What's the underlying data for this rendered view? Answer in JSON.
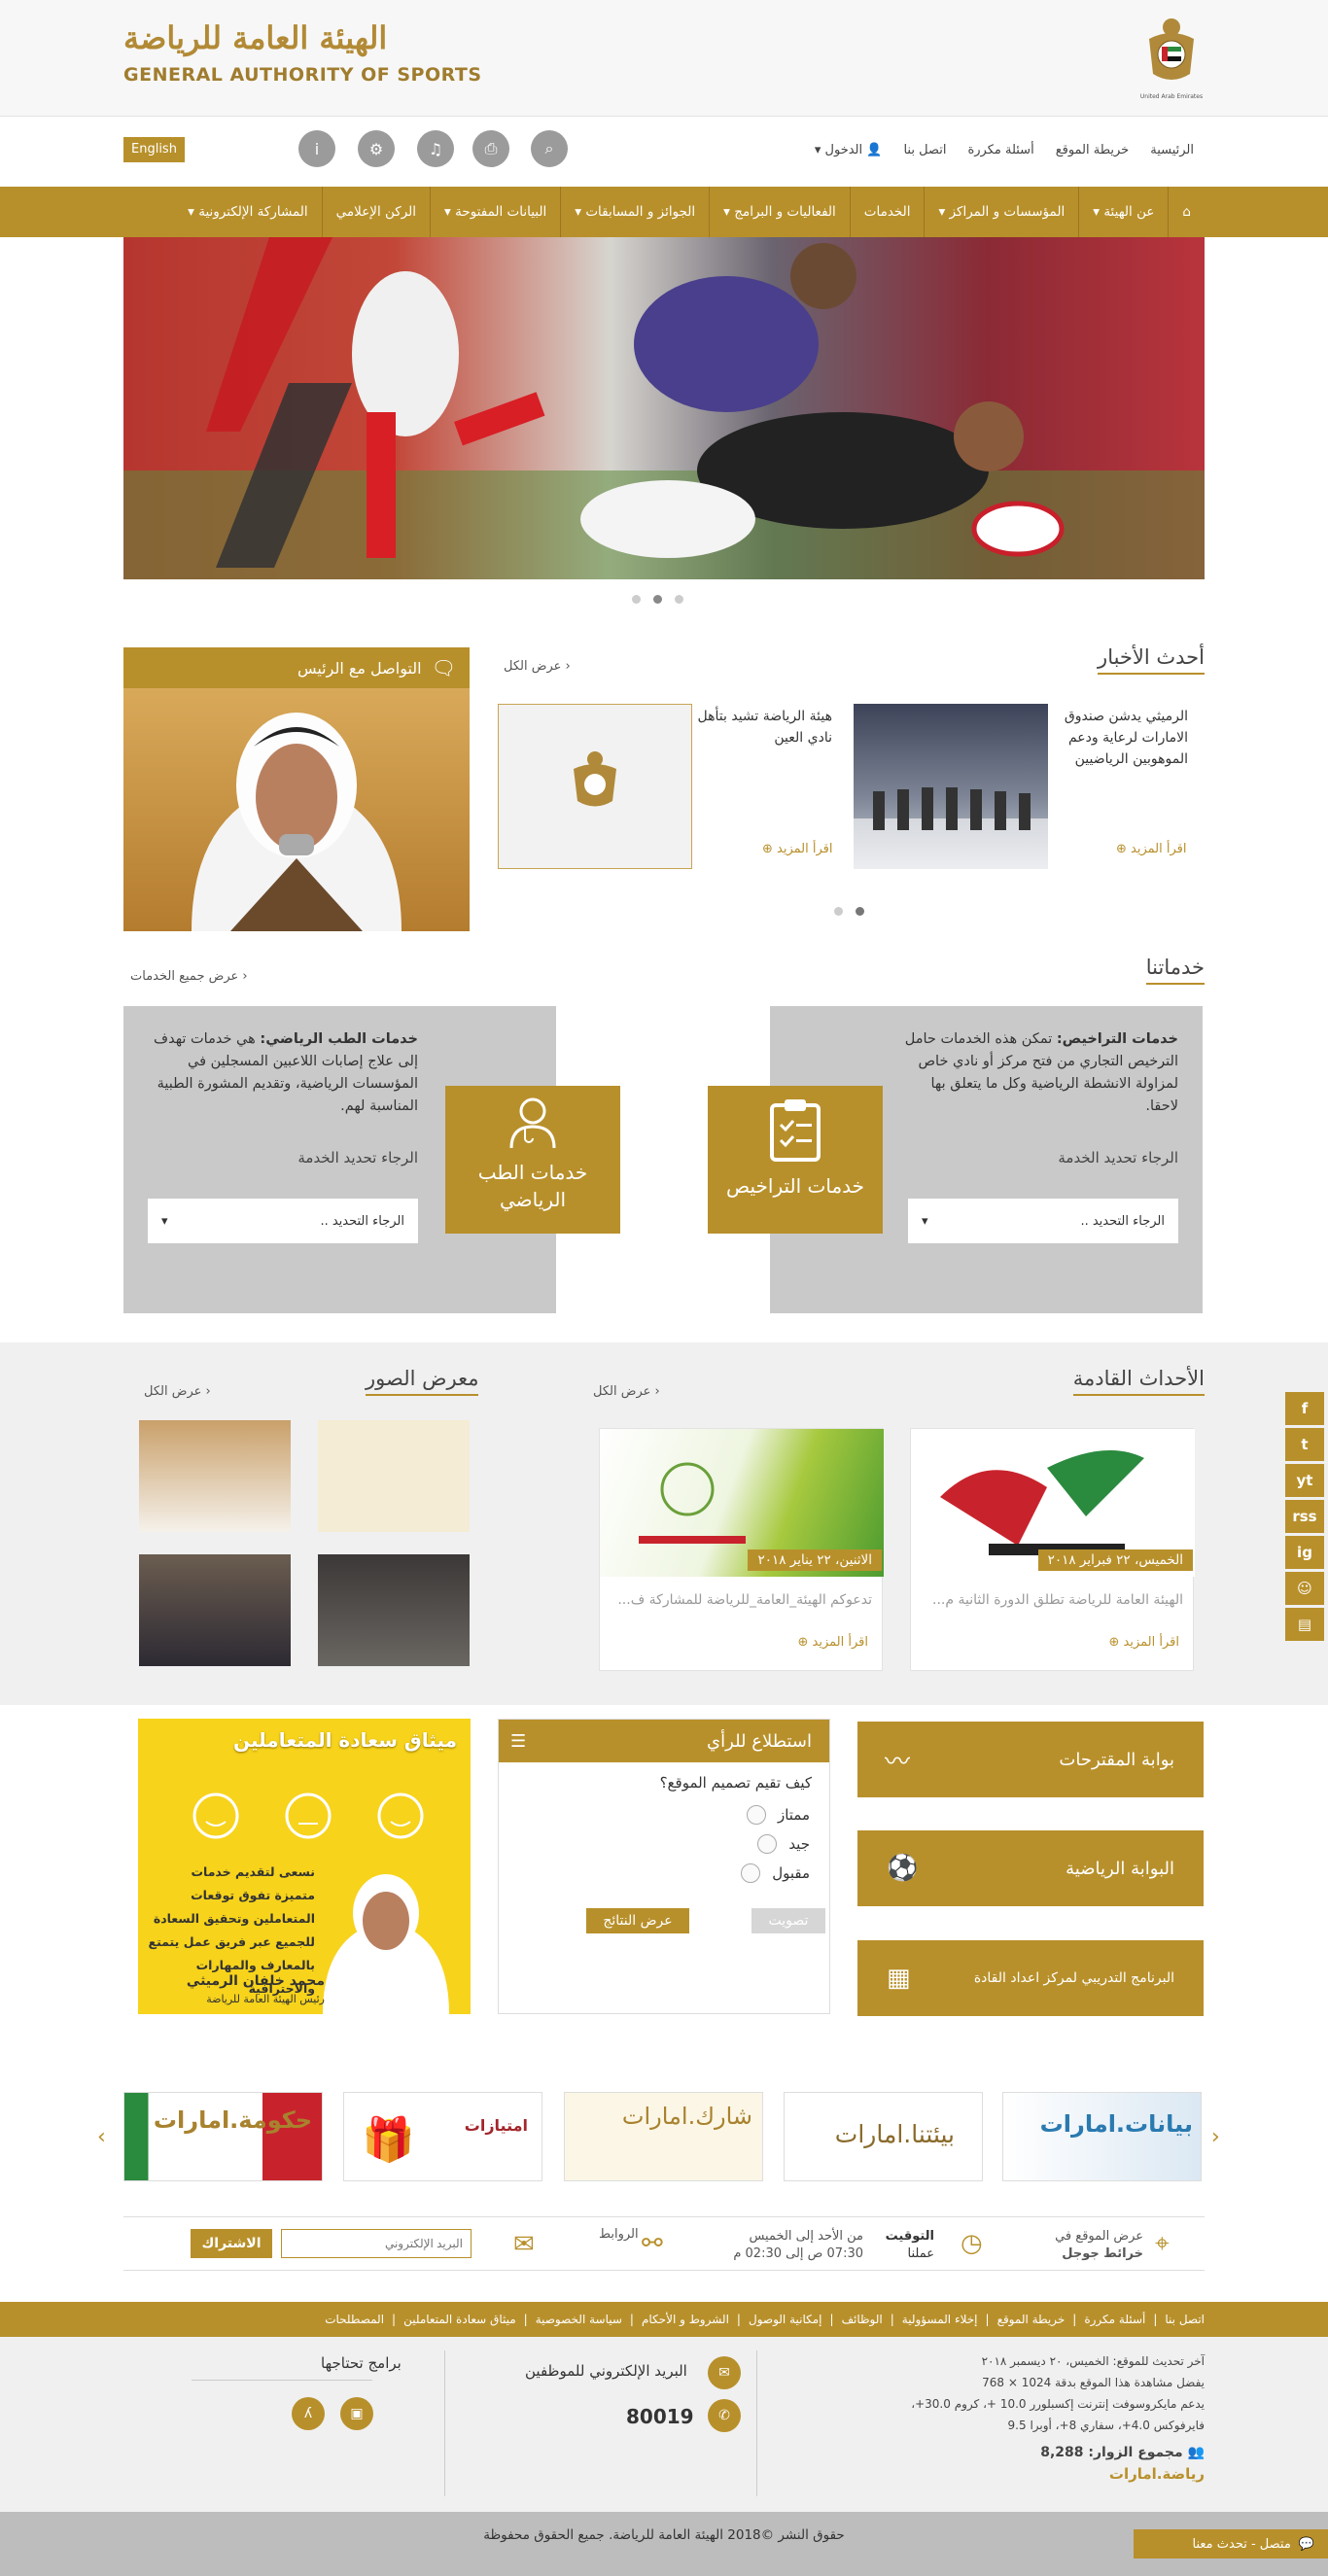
{
  "header": {
    "logo_ar": "الهيئة العامة للرياضة",
    "logo_en": "GENERAL AUTHORITY OF SPORTS",
    "emblem_caption": "United Arab Emirates"
  },
  "topbar": {
    "lang": "English",
    "links": [
      "الرئيسية",
      "خريطة الموقع",
      "أسئلة مكررة",
      "اتصل بنا",
      "الدخول"
    ],
    "tools": [
      "search-icon",
      "print-icon",
      "sound-icon",
      "settings-icon",
      "info-icon"
    ]
  },
  "nav": {
    "items": [
      "⌂",
      "عن الهيئة",
      "المؤسسات و المراكز",
      "الخدمات",
      "الفعاليات و البرامج",
      "الجوائز و المسابقات",
      "البيانات المفتوحة",
      "الركن الإعلامي",
      "المشاركة الإلكترونية"
    ]
  },
  "news": {
    "title": "أحدث الأخبار",
    "view_all": "عرض الكل",
    "items": [
      {
        "text": "الرميثي يدشن صندوق الامارات لرعاية ودعم الموهوبين الرياضيين",
        "more": "اقرأ المزيد"
      },
      {
        "text": "هيئة الرياضة تشيد بتأهل نادي العين",
        "more": "اقرأ المزيد"
      }
    ]
  },
  "chairman": {
    "title": "التواصل مع الرئيس"
  },
  "services": {
    "title": "خدماتنا",
    "view_all": "عرض جميع الخدمات",
    "licensing": {
      "desc_bold": "خدمات التراخيص:",
      "desc": "تمكن هذه الخدمات حامل الترخيص التجاري من فتح مركز أو نادي خاص لمزاولة الانشطة الرياضية وكل ما يتعلق بها لاحقا.",
      "select_label": "الرجاء تحديد الخدمة",
      "select_value": "الرجاء التحديد ..",
      "button": "خدمات التراخيص"
    },
    "medical": {
      "desc_bold": "خدمات الطب الرياضي:",
      "desc": "هي خدمات تهدف إلى علاج إصابات اللاعبين المسجلين في المؤسسات الرياضية، وتقديم المشورة الطبية المناسبة لهم.",
      "select_label": "الرجاء تحديد الخدمة",
      "select_value": "الرجاء التحديد ..",
      "button": "خدمات الطب الرياضي"
    }
  },
  "events": {
    "title": "الأحداث القادمة",
    "view_all": "عرض الكل",
    "items": [
      {
        "date": "الخميس، ٢٢ فبراير ٢٠١٨",
        "text": "الهيئة العامة للرياضة تطلق الدورة الثانية م...",
        "more": "اقرأ المزيد"
      },
      {
        "date": "الاثنين، ٢٢ يناير ٢٠١٨",
        "text": "تدعوكم الهيئة_العامة_للرياضة للمشاركة ف...",
        "more": "اقرأ المزيد"
      }
    ]
  },
  "gallery": {
    "title": "معرض الصور",
    "view_all": "عرض الكل"
  },
  "portals": {
    "suggestions": "بوابة المقترحات",
    "sports": "البوابة الرياضية",
    "training": "البرنامج التدريبي لمركز اعداد القادة"
  },
  "poll": {
    "title": "استطلاع للرأي",
    "question": "كيف تقيم تصميم الموقع؟",
    "options": [
      "ممتاز",
      "جيد",
      "مقبول"
    ],
    "vote": "تصويت",
    "results": "عرض النتائج"
  },
  "charter": {
    "title": "ميثاق سعادة المتعاملين",
    "text": "نسعى لتقديم خدمات متميزة تفوق توقعات المتعاملين وتحقيق السعادة للجميع عبر فريق عمل يتمتع بالمعارف والمهارات والاحترافية",
    "name": "محمد خلفان الرميثي",
    "role": "رئيس الهيئة العامة للرياضة"
  },
  "partners": [
    "بيانات.امارات",
    "بيئتنا.امارات",
    "شارك.امارات",
    "امتيازات",
    "حكومة.امارات"
  ],
  "info": {
    "map_line1": "عرض الموقع في",
    "map_line2": "خرائط جوجل",
    "timing_title": "التوقيت",
    "timing_sub": "عملنا",
    "timing_days": "من الأحد إلى الخميس",
    "timing_hours": "07:30 ص إلى 02:30 م",
    "links": "الروابط",
    "email_placeholder": "البريد الإلكتروني",
    "subscribe": "الاشتراك"
  },
  "footer": {
    "links": [
      "اتصل بنا",
      "أسئلة مكررة",
      "خريطة الموقع",
      "إخلاء المسؤولية",
      "الوظائف",
      "إمكانية الوصول",
      "الشروط و الأحكام",
      "سياسة الخصوصية",
      "ميثاق سعادة المتعاملين",
      "المصطلحات"
    ],
    "last_update": "آخر تحديث للموقع: الخميس، ٢٠ ديسمبر ٢٠١٨",
    "resolution": "يفضل مشاهدة هذا الموقع بدقة 1024 × 768",
    "browsers": "يدعم مايكروسوفت إنترنت إكسبلورر 10.0 +، كروم 30.0+، فايرفوكس 4.0+، سفاري 8+، أوبرا 9.5",
    "visitors_label": "مجموع الزوار:",
    "visitors": "8,288",
    "site": "رياضة.امارات",
    "staff_email": "البريد الإلكتروني للموظفين",
    "phone": "80019",
    "apps_title": "برامج تحتاجها",
    "copyright": "حقوق النشر ©2018 الهيئة العامة للرياضة. جميع الحقوق محفوظة",
    "chat": "متصل - تحدث معنا"
  },
  "social": [
    "f",
    "t",
    "yt",
    "rss",
    "ig",
    "☺",
    "▤"
  ]
}
